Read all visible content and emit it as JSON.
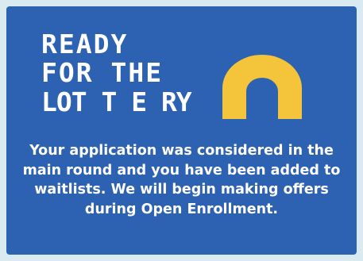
{
  "card": {
    "headline_lines": [
      "READY",
      "FOR THE",
      "LOT T E RY"
    ],
    "message": "Your application was considered in the main round and you have been added to waitlists. We will begin making offers during Open Enrollment."
  },
  "colors": {
    "page_background": "#d9ebf0",
    "card_background": "#2d61b2",
    "text": "#ffffff",
    "rainbow": "#f4c43a"
  },
  "icons": {
    "rainbow": "rainbow-icon"
  }
}
